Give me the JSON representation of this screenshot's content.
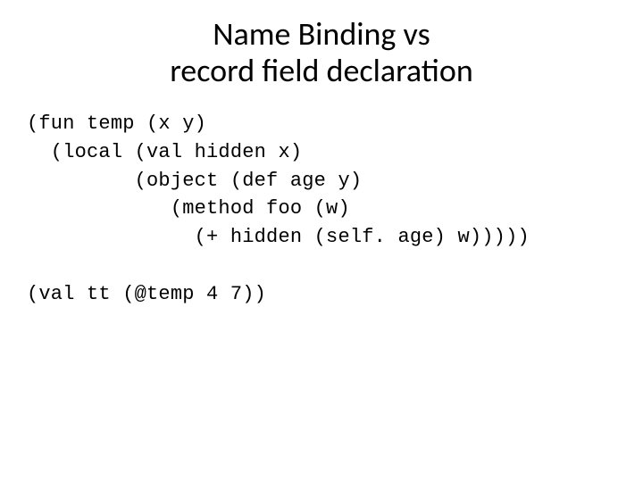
{
  "title": {
    "line1": "Name Binding vs",
    "line2": "record field declaration"
  },
  "code": {
    "l1": "(fun temp (x y)",
    "l2": "  (local (val hidden x)",
    "l3": "         (object (def age y)",
    "l4": "            (method foo (w)",
    "l5": "              (+ hidden (self. age) w)))))",
    "l6": "",
    "l7": "(val tt (@temp 4 7))"
  }
}
